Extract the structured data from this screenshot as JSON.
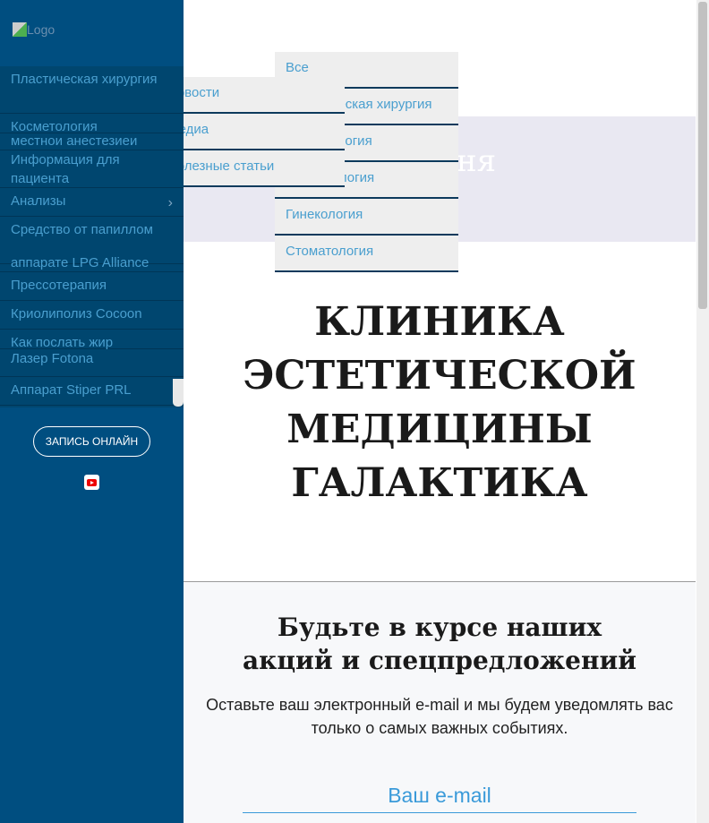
{
  "sidebar": {
    "logo_alt": "Logo",
    "menu": [
      {
        "label": "Пластическая хирургия"
      },
      {
        "label": "Косметология"
      },
      {
        "label": "местнои анестезиеи"
      },
      {
        "label": "Информация для пациента"
      },
      {
        "label": "Анализы",
        "has_submenu": true
      },
      {
        "label": "Средство от папиллом"
      },
      {
        "label": "аппарате LPG Alliance"
      },
      {
        "label": "Прессотерапия"
      },
      {
        "label": "Криолиполиз Cocoon"
      },
      {
        "label": "Как послать жир"
      },
      {
        "label": "Лазер Fotona"
      },
      {
        "label": "Аппарат Stiper PRL"
      }
    ],
    "record_button": "ЗАПИСЬ ОНЛАЙН",
    "youtube_icon": "youtube-icon"
  },
  "dropdown_categories": [
    "Все",
    "Пластическая хирургия",
    "Косметология",
    "Дерматология",
    "Гинекология",
    "Стоматология"
  ],
  "dropdown_blog": [
    "Новости",
    "Медиа",
    "Полезные статьи"
  ],
  "hero": {
    "text": "ня"
  },
  "title": [
    "КЛИНИКА",
    "ЭСТЕТИЧЕСКОЙ",
    "МЕДИЦИНЫ",
    "ГАЛАКТИКА"
  ],
  "subscribe": {
    "heading": [
      "Будьте в курсе наших",
      "акций и спецпредложений"
    ],
    "text": "Оставьте ваш электронный e-mail и мы будем уведомлять вас только о самых важных событиях.",
    "email_placeholder": "Ваш e-mail"
  }
}
